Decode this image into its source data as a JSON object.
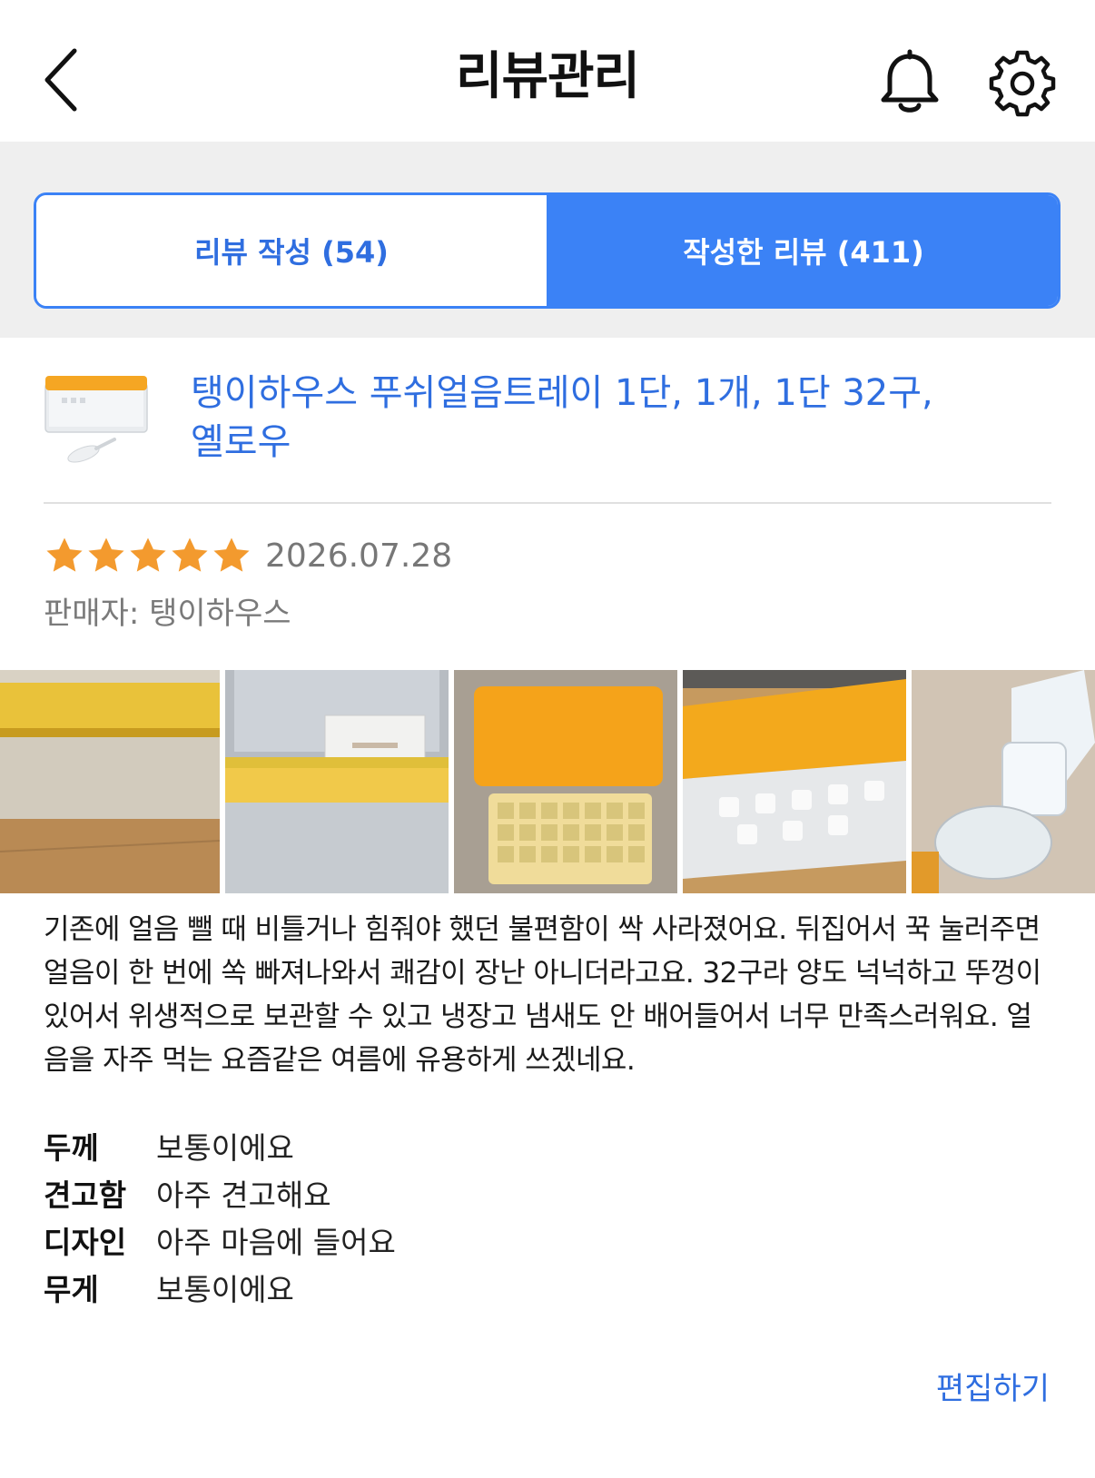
{
  "header": {
    "title": "리뷰관리",
    "back_icon": "chevron-left-icon",
    "bell_icon": "bell-icon",
    "settings_icon": "gear-icon"
  },
  "tabs": [
    {
      "label": "리뷰 작성 (54)",
      "selected": false
    },
    {
      "label": "작성한 리뷰 (411)",
      "selected": true
    }
  ],
  "product": {
    "name": "탱이하우스 푸쉬얼음트레이 1단, 1개, 1단 32구, 옐로우"
  },
  "review": {
    "rating": 5,
    "max_rating": 5,
    "date": "2026.07.28",
    "seller": "판매자: 탱이하우스",
    "text": "기존에 얼음 뺄 때 비틀거나 힘줘야 했던 불편함이 싹 사라졌어요. 뒤집어서 꾹 눌러주면 얼음이 한 번에 쏙 빠져나와서 쾌감이 장난 아니더라고요. 32구라 양도 넉넉하고 뚜껑이 있어서 위생적으로 보관할 수 있고 냉장고 냄새도 안 배어들어서 너무 만족스러워요. 얼음을 자주 먹는 요즘같은 여름에 유용하게 쓰겠네요.",
    "attributes": [
      {
        "key": "두께",
        "value": "보통이에요"
      },
      {
        "key": "견고함",
        "value": "아주 견고해요"
      },
      {
        "key": "디자인",
        "value": "아주 마음에 들어요"
      },
      {
        "key": "무게",
        "value": "보통이에요"
      }
    ],
    "photo_count": 5
  },
  "actions": {
    "edit_label": "편집하기"
  },
  "colors": {
    "accent": "#3b82f6",
    "link": "#2f6ee0",
    "star": "#f39a2e",
    "product_yellow": "#f5a623"
  }
}
